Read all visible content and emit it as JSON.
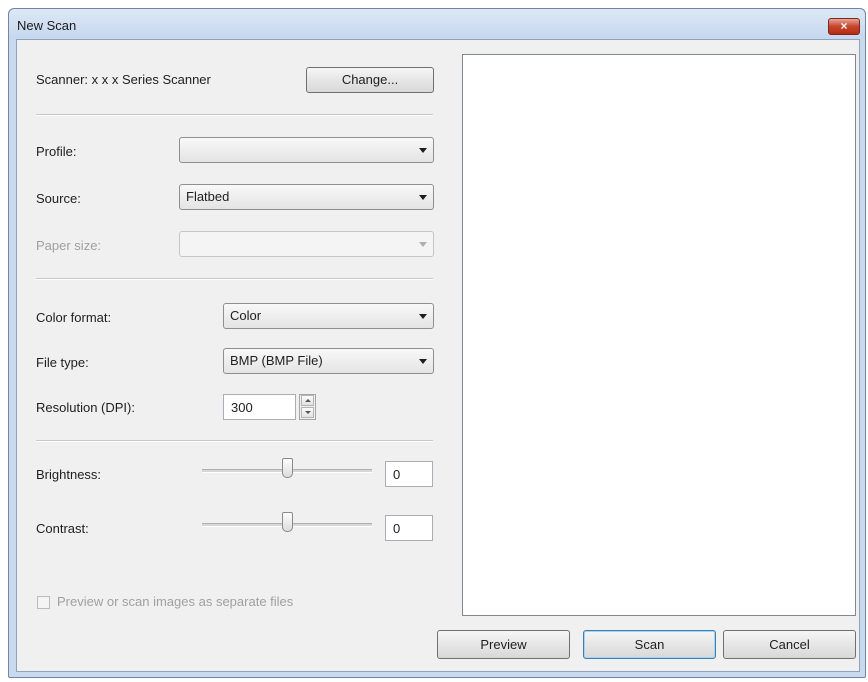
{
  "window": {
    "title": "New Scan",
    "close_label": "×"
  },
  "scanner": {
    "label": "Scanner: x x x  Series Scanner",
    "change_button": "Change..."
  },
  "profile": {
    "label": "Profile:",
    "value": ""
  },
  "source": {
    "label": "Source:",
    "value": "Flatbed"
  },
  "paper_size": {
    "label": "Paper size:",
    "value": ""
  },
  "color_format": {
    "label": "Color format:",
    "value": "Color"
  },
  "file_type": {
    "label": "File type:",
    "value": "BMP (BMP File)"
  },
  "resolution": {
    "label": "Resolution (DPI):",
    "value": "300"
  },
  "brightness": {
    "label": "Brightness:",
    "value": "0",
    "level_percent": 50
  },
  "contrast": {
    "label": "Contrast:",
    "value": "0",
    "level_percent": 50
  },
  "separate_files": {
    "label": "Preview or scan images as separate files",
    "checked": false
  },
  "buttons": {
    "preview": "Preview",
    "scan": "Scan",
    "cancel": "Cancel"
  }
}
